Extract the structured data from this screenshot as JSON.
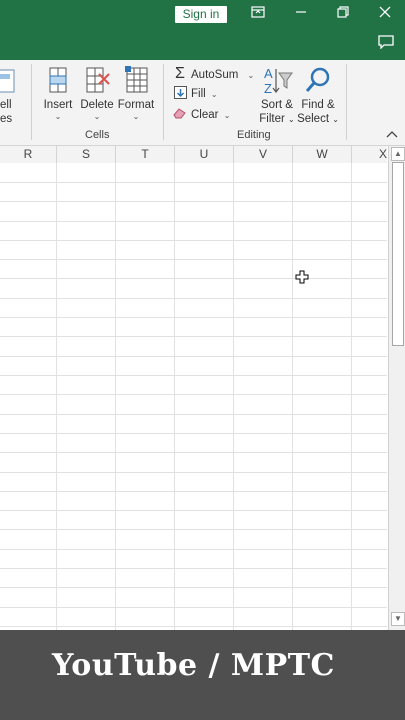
{
  "titlebar": {
    "sign_in": "Sign in",
    "icons": [
      "ribbon-display-options-icon",
      "minimize-icon",
      "restore-icon",
      "close-icon"
    ],
    "comments_icon": "comments-icon",
    "color": "#217346"
  },
  "ribbon": {
    "cells_group": {
      "label": "Cells",
      "partial_cell_styles": {
        "line1": "ell",
        "line2": "es"
      },
      "insert": "Insert",
      "delete": "Delete",
      "format": "Format"
    },
    "editing_group": {
      "label": "Editing",
      "autosum": "AutoSum",
      "fill": "Fill",
      "clear": "Clear",
      "sort_filter": {
        "line1": "Sort &",
        "line2": "Filter"
      },
      "find_select": {
        "line1": "Find &",
        "line2": "Select"
      }
    }
  },
  "sheet": {
    "columns": [
      "R",
      "S",
      "T",
      "U",
      "V",
      "W",
      "X"
    ]
  },
  "banner": {
    "text": "YouTube / MPTC"
  }
}
